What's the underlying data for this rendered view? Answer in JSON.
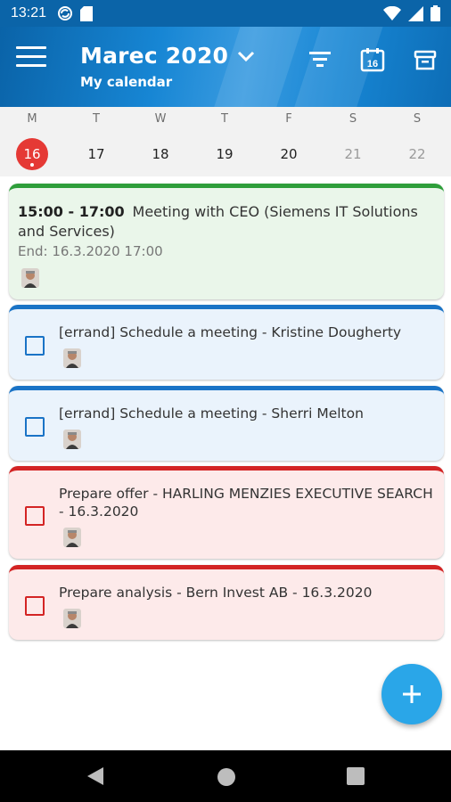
{
  "status_bar": {
    "time": "13:21",
    "left_icons": [
      "sync-icon",
      "sd-card-icon"
    ],
    "right_icons": [
      "wifi-icon",
      "signal-icon",
      "battery-icon"
    ]
  },
  "app_bar": {
    "title": "Marec 2020",
    "subtitle": "My calendar",
    "icons": [
      "menu-icon",
      "chevron-down-icon",
      "filter-icon",
      "calendar-today-icon",
      "archive-icon"
    ],
    "today_icon_number": "16"
  },
  "week": {
    "days": [
      {
        "letter": "M",
        "num": "16",
        "state": "today"
      },
      {
        "letter": "T",
        "num": "17",
        "state": "normal"
      },
      {
        "letter": "W",
        "num": "18",
        "state": "normal"
      },
      {
        "letter": "T",
        "num": "19",
        "state": "normal"
      },
      {
        "letter": "F",
        "num": "20",
        "state": "normal"
      },
      {
        "letter": "S",
        "num": "21",
        "state": "weekend"
      },
      {
        "letter": "S",
        "num": "22",
        "state": "weekend"
      }
    ]
  },
  "items": {
    "event": {
      "time": "15:00 - 17:00",
      "title": "Meeting with CEO (Siemens IT Solutions and Services)",
      "end": "End: 16.3.2020 17:00",
      "color": "#2e9e3a"
    },
    "task1": {
      "text": "[errand] Schedule a meeting - Kristine Dougherty",
      "color": "#1a73c6"
    },
    "task2": {
      "text": "[errand] Schedule a meeting - Sherri Melton",
      "color": "#1a73c6"
    },
    "task3": {
      "text": "Prepare offer - HARLING MENZIES EXECUTIVE SEARCH - 16.3.2020",
      "color": "#d32424"
    },
    "task4": {
      "text": "Prepare analysis - Bern Invest AB - 16.3.2020",
      "color": "#d32424"
    }
  },
  "fab": {
    "icon": "plus-icon",
    "color": "#2aa6e8"
  },
  "nav_bar": {
    "icons": [
      "back-icon",
      "home-icon",
      "recents-icon"
    ]
  },
  "colors": {
    "app_bar": "#1786d4",
    "today": "#e53935"
  }
}
